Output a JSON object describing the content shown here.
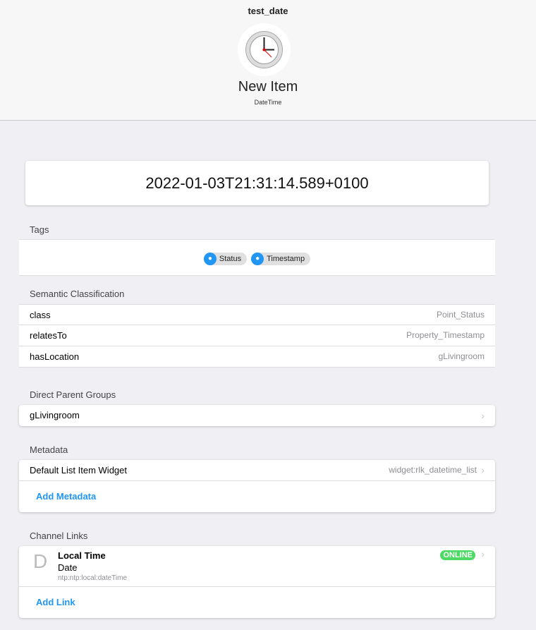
{
  "header": {
    "title": "test_date",
    "item_label": "New Item",
    "item_type": "DateTime",
    "icon": "clock-icon"
  },
  "state": "2022-01-03T21:31:14.589+0100",
  "tags": {
    "heading": "Tags",
    "items": [
      "Status",
      "Timestamp"
    ]
  },
  "semantic": {
    "heading": "Semantic Classification",
    "rows": [
      {
        "key": "class",
        "value": "Point_Status"
      },
      {
        "key": "relatesTo",
        "value": "Property_Timestamp"
      },
      {
        "key": "hasLocation",
        "value": "gLivingroom"
      }
    ]
  },
  "parents": {
    "heading": "Direct Parent Groups",
    "items": [
      "gLivingroom"
    ]
  },
  "metadata": {
    "heading": "Metadata",
    "rows": [
      {
        "key": "Default List Item Widget",
        "value": "widget:rlk_datetime_list"
      }
    ],
    "add_label": "Add Metadata"
  },
  "channels": {
    "heading": "Channel Links",
    "links": [
      {
        "letter": "D",
        "title": "Local Time",
        "subtitle": "Date",
        "uid": "ntp:ntp:local:dateTime",
        "status": "ONLINE"
      }
    ],
    "add_label": "Add Link"
  },
  "colors": {
    "accent": "#2196f3",
    "online": "#4cd964"
  }
}
